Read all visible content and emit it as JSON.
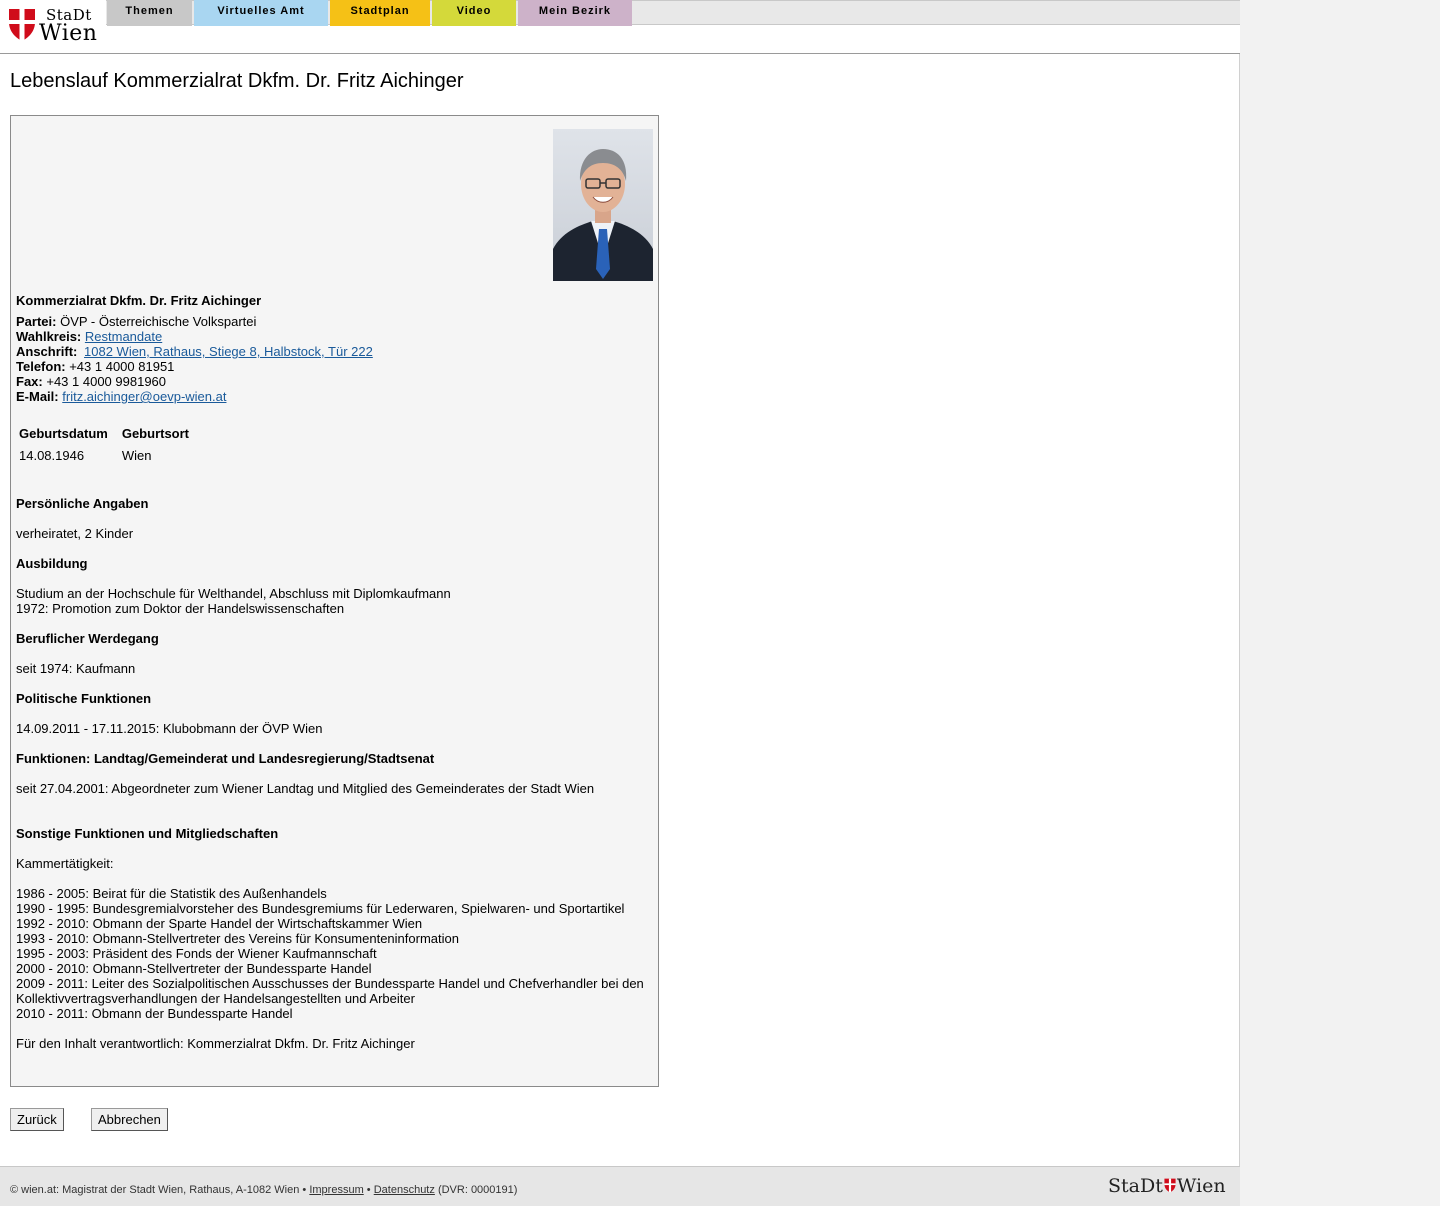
{
  "logo": {
    "line1": "StaDt",
    "line2": "Wien"
  },
  "nav": {
    "tabs": [
      {
        "label": "Themen",
        "color": "#c8c8c8"
      },
      {
        "label": "Virtuelles Amt",
        "color": "#a9d6f1"
      },
      {
        "label": "Stadtplan",
        "color": "#f5c116"
      },
      {
        "label": "Video",
        "color": "#d4d93a"
      },
      {
        "label": "Mein Bezirk",
        "color": "#cdb2c9"
      }
    ]
  },
  "page_title": "Lebenslauf Kommerzialrat Dkfm. Dr. Fritz Aichinger",
  "profile": {
    "name": "Kommerzialrat Dkfm. Dr. Fritz Aichinger",
    "party_label": "Partei:",
    "party": "ÖVP - Österreichische Volkspartei",
    "district_label": "Wahlkreis:",
    "district": "Restmandate",
    "address_label": "Anschrift:",
    "address": "1082 Wien, Rathaus, Stiege 8, Halbstock, Tür 222",
    "phone_label": "Telefon:",
    "phone": "+43 1 4000 81951",
    "fax_label": "Fax:",
    "fax": "+43 1 4000 9981960",
    "email_label": "E-Mail:",
    "email": "fritz.aichinger@oevp-wien.at",
    "birth": {
      "headers": [
        "Geburtsdatum",
        "Geburtsort"
      ],
      "values": [
        "14.08.1946",
        "Wien"
      ]
    },
    "personal": {
      "heading": "Persönliche Angaben",
      "text": "verheiratet, 2 Kinder"
    },
    "education": {
      "heading": "Ausbildung",
      "lines": [
        "Studium an der Hochschule für Welthandel, Abschluss mit Diplomkaufmann",
        "1972: Promotion zum Doktor der Handelswissenschaften"
      ]
    },
    "career": {
      "heading": "Beruflicher Werdegang",
      "text": "seit 1974: Kaufmann"
    },
    "political": {
      "heading": "Politische Funktionen",
      "text": "14.09.2011 - 17.11.2015: Klubobmann der ÖVP Wien"
    },
    "functions": {
      "heading": "Funktionen: Landtag/Gemeinderat und Landesregierung/Stadtsenat",
      "text": "seit 27.04.2001: Abgeordneter zum Wiener Landtag und Mitglied des Gemeinderates der Stadt Wien"
    },
    "other": {
      "heading": "Sonstige Funktionen und Mitgliedschaften",
      "intro": "Kammertätigkeit:",
      "lines": [
        "1986 - 2005: Beirat für die Statistik des Außenhandels",
        "1990 - 1995: Bundesgremialvorsteher des Bundesgremiums für Lederwaren, Spielwaren- und Sportartikel",
        "1992 - 2010: Obmann der Sparte Handel der Wirtschaftskammer Wien",
        "1993 - 2010: Obmann-Stellvertreter des Vereins für Konsumenteninformation",
        "1995 - 2003: Präsident des Fonds der Wiener Kaufmannschaft",
        "2000 - 2010: Obmann-Stellvertreter der Bundessparte Handel",
        "2009 - 2011: Leiter des Sozialpolitischen Ausschusses der Bundessparte Handel und Chefverhandler bei den",
        "Kollektivvertragsverhandlungen der Handelsangestellten und Arbeiter",
        "2010 - 2011: Obmann der Bundessparte Handel"
      ]
    },
    "responsible": "Für den Inhalt verantwortlich: Kommerzialrat Dkfm. Dr. Fritz Aichinger"
  },
  "buttons": {
    "back": "Zurück",
    "cancel": "Abbrechen"
  },
  "footer": {
    "copyright": "© wien.at: Magistrat der Stadt Wien, Rathaus, A-1082 Wien •",
    "imprint": "Impressum",
    "sep": "•",
    "privacy": "Datenschutz",
    "dvr": "(DVR: 0000191)",
    "logo_left": "StaDt",
    "logo_right": "Wien"
  }
}
